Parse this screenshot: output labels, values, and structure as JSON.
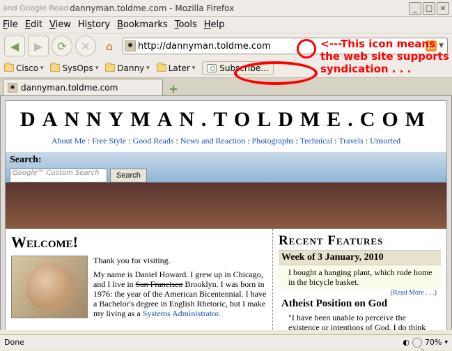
{
  "window": {
    "title_prefix": "and Google Read",
    "title": "dannyman.toldme.com - Mozilla Firefox"
  },
  "menu": {
    "file": "File",
    "edit": "Edit",
    "view": "View",
    "history": "History",
    "bookmarks": "Bookmarks",
    "tools": "Tools",
    "help": "Help"
  },
  "url": "http://dannyman.toldme.com",
  "annotation": {
    "line1": "<---This icon means",
    "line2": "the web site supports",
    "line3": "syndication . . ."
  },
  "bookmarks": {
    "b0": "Cisco",
    "b1": "SysOps",
    "b2": "Danny",
    "b3": "Later",
    "subscribe": "Subscribe..."
  },
  "tab": {
    "label": "dannyman.toldme.com"
  },
  "page": {
    "title": "DANNYMAN.TOLDME.COM",
    "nav": {
      "about": "About Me",
      "free": "Free Style",
      "good": "Good Reads",
      "news": "News and Reaction",
      "photo": "Photographs",
      "tech": "Technical",
      "travels": "Travels",
      "unsorted": "Unsorted"
    },
    "search_label": "Search:",
    "search_placeholder": "Google™ Custom Search",
    "search_button": "Search",
    "welcome_heading": "Welcome!",
    "welcome_thanks": "Thank you for visiting.",
    "welcome_para1a": "My name is Daniel Howard. I grew up in Chicago, and I live in ",
    "welcome_strike": "San Francisco",
    "welcome_para1b": " Brooklyn. I was born in 1976: the year of the American Bicentennial. I have a Bachelor's degree in English Rhetoric, but I make my living as a ",
    "welcome_link": "Systems Administrator",
    "welcome_period": ".",
    "recent_heading": "Recent Features",
    "week_heading": "Week of 3 January, 2010",
    "week_body": "I bought a hanging plant, which rode home in the bicycle basket.",
    "readmore": "(Read More . . .)",
    "atheist_heading": "Atheist Position on God",
    "atheist_body": "\"I have been unable to perceive the existence or intentions of God. I do think that Faith is important, and I put my faith"
  },
  "status": {
    "text": "Done",
    "zoom": "70%"
  }
}
